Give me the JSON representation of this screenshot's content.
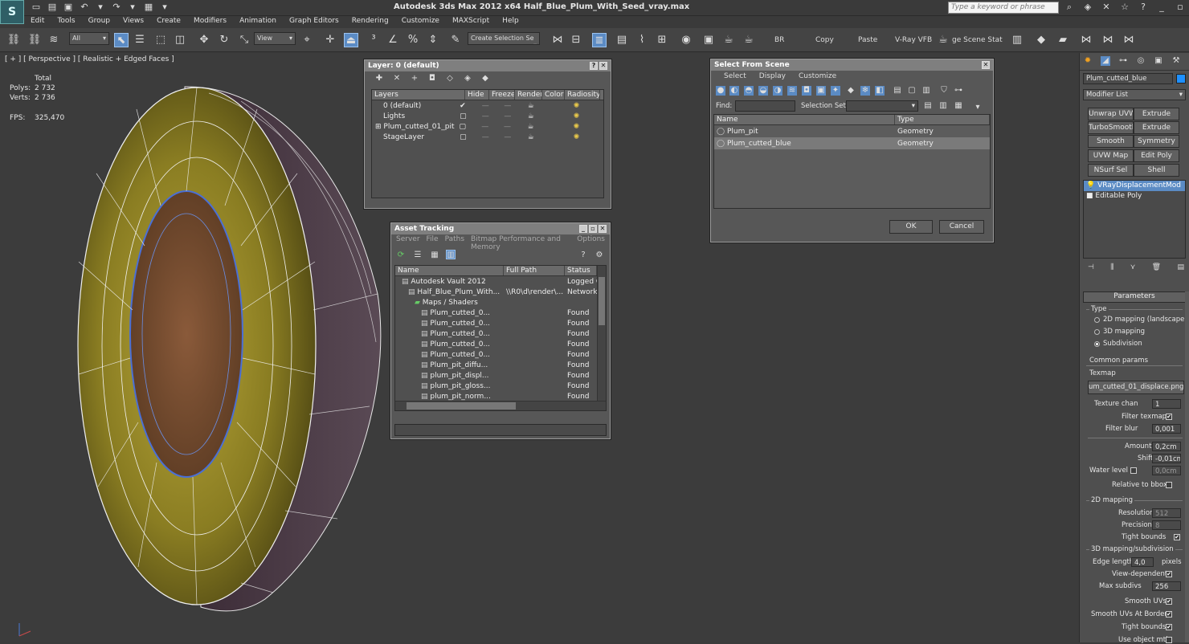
{
  "app": {
    "title": "Autodesk 3ds Max  2012 x64      Half_Blue_Plum_With_Seed_vray.max",
    "logo": "3ds-max-logo",
    "search_placeholder": "Type a keyword or phrase"
  },
  "menu": [
    "Edit",
    "Tools",
    "Group",
    "Views",
    "Create",
    "Modifiers",
    "Animation",
    "Graph Editors",
    "Rendering",
    "Customize",
    "MAXScript",
    "Help"
  ],
  "toolbar": {
    "filter_value": "All",
    "refcoord_value": "View",
    "selection_set_placeholder": "Create Selection Se",
    "text_buttons": [
      "BR",
      "Copy",
      "Paste",
      "V-Ray VFB",
      "ge Scene Stat"
    ]
  },
  "viewport": {
    "label": "[ + ] [ Perspective ] [ Realistic + Edged Faces ]",
    "stats": {
      "total_label": "Total",
      "polys_label": "Polys:",
      "polys_value": "2 732",
      "verts_label": "Verts:",
      "verts_value": "2 736",
      "fps_label": "FPS:",
      "fps_value": "325,470"
    }
  },
  "layer_dialog": {
    "title": "Layer: 0 (default)",
    "columns": [
      "Layers",
      "Hide",
      "Freeze",
      "Render",
      "Color",
      "Radiosity"
    ],
    "rows": [
      {
        "name": "0 (default)",
        "current": true,
        "color": "#8b1a1a"
      },
      {
        "name": "Lights",
        "current": false,
        "color": "#e8d88a"
      },
      {
        "name": "Plum_cutted_01_pit",
        "current": false,
        "color": "#1a2a9a"
      },
      {
        "name": "StageLayer",
        "current": false,
        "color": "#1a2a9a"
      }
    ]
  },
  "asset_tracking": {
    "title": "Asset Tracking",
    "menu": [
      "Server",
      "File",
      "Paths",
      "Bitmap Performance and Memory",
      "Options"
    ],
    "columns": [
      "Name",
      "Full Path",
      "Status"
    ],
    "rows": [
      {
        "name": "Autodesk Vault 2012",
        "path": "",
        "status": "Logged O",
        "indent": 1
      },
      {
        "name": "Half_Blue_Plum_With...",
        "path": "\\\\R0\\d\\render\\...",
        "status": "Network F",
        "indent": 2
      },
      {
        "name": "Maps / Shaders",
        "path": "",
        "status": "",
        "indent": 3
      },
      {
        "name": "Plum_cutted_0...",
        "path": "",
        "status": "Found",
        "indent": 4
      },
      {
        "name": "Plum_cutted_0...",
        "path": "",
        "status": "Found",
        "indent": 4
      },
      {
        "name": "Plum_cutted_0...",
        "path": "",
        "status": "Found",
        "indent": 4
      },
      {
        "name": "Plum_cutted_0...",
        "path": "",
        "status": "Found",
        "indent": 4
      },
      {
        "name": "Plum_cutted_0...",
        "path": "",
        "status": "Found",
        "indent": 4
      },
      {
        "name": "Plum_pit_diffu...",
        "path": "",
        "status": "Found",
        "indent": 4
      },
      {
        "name": "plum_pit_displ...",
        "path": "",
        "status": "Found",
        "indent": 4
      },
      {
        "name": "plum_pit_gloss...",
        "path": "",
        "status": "Found",
        "indent": 4
      },
      {
        "name": "plum_pit_norm...",
        "path": "",
        "status": "Found",
        "indent": 4
      }
    ]
  },
  "select_scene": {
    "title": "Select From Scene",
    "menu": [
      "Select",
      "Display",
      "Customize"
    ],
    "find_label": "Find:",
    "selection_set_label": "Selection Set:",
    "columns": [
      "Name",
      "Type"
    ],
    "rows": [
      {
        "name": "Plum_pit",
        "type": "Geometry",
        "selected": false
      },
      {
        "name": "Plum_cutted_blue",
        "type": "Geometry",
        "selected": true
      }
    ],
    "ok_label": "OK",
    "cancel_label": "Cancel"
  },
  "command_panel": {
    "object_name": "Plum_cutted_blue",
    "object_color": "#1e90ff",
    "modifier_list_label": "Modifier List",
    "modifier_buttons": [
      "Unwrap UVW",
      "Extrude",
      "TurboSmooth",
      "Extrude",
      "Smooth",
      "Symmetry",
      "UVW Map",
      "Edit Poly",
      "NSurf Sel",
      "Shell"
    ],
    "stack": [
      "VRayDisplacementMod",
      "Editable Poly"
    ],
    "params": {
      "rollout_title": "Parameters",
      "type_label": "Type",
      "type_options": [
        "2D mapping (landscape)",
        "3D mapping",
        "Subdivision"
      ],
      "type_selected": 2,
      "common_params_label": "Common params",
      "texmap_label": "Texmap",
      "texmap_value": "um_cutted_01_displace.png)",
      "texture_chan_label": "Texture chan",
      "texture_chan_value": "1",
      "filter_texmap_label": "Filter texmap",
      "filter_blur_label": "Filter blur",
      "filter_blur_value": "0,001",
      "amount_label": "Amount",
      "amount_value": "0,2cm",
      "shift_label": "Shift",
      "shift_value": "-0,01cm",
      "water_level_label": "Water level",
      "water_level_value": "0,0cm",
      "relative_bbox_label": "Relative to bbox",
      "mapping2d_label": "2D mapping",
      "resolution_label": "Resolution",
      "resolution_value": "512",
      "precision_label": "Precision",
      "precision_value": "8",
      "tight_bounds_label": "Tight bounds",
      "mapping3d_label": "3D mapping/subdivision",
      "edge_length_label": "Edge length",
      "edge_length_value": "4,0",
      "pixels_label": "pixels",
      "view_dependent_label": "View-dependent",
      "max_subdivs_label": "Max subdivs",
      "max_subdivs_value": "256",
      "smooth_uvs_label": "Smooth UVs",
      "smooth_uvs_borders_label": "Smooth UVs At Borders",
      "tight_bounds2_label": "Tight bounds",
      "use_object_mtl_label": "Use object mtl"
    }
  }
}
